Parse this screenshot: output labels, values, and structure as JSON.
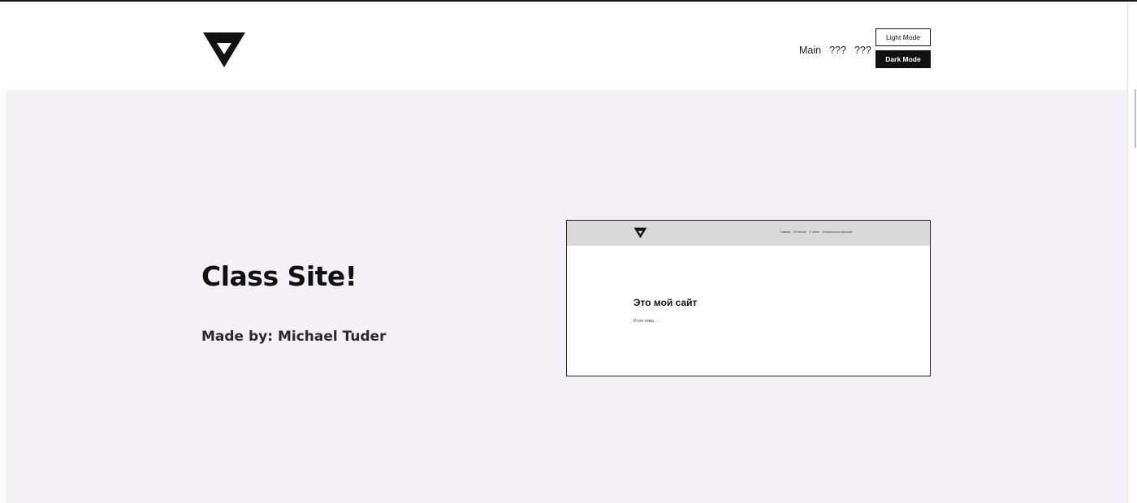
{
  "header": {
    "logo_icon": "inverted-triangle-logo",
    "nav": [
      {
        "label": "Main"
      },
      {
        "label": "???"
      },
      {
        "label": "???"
      }
    ],
    "light_mode_label": "Light Mode",
    "dark_mode_label": "Dark Mode"
  },
  "hero": {
    "title": "Class Site!",
    "subtitle": "Made by: Michael Tuder"
  },
  "preview": {
    "logo_icon": "inverted-triangle-logo",
    "nav": [
      "Главная",
      "Об авторе",
      "О сайте",
      "Специальные функции"
    ],
    "title": "Это мой сайт",
    "text": "И его тема . . ."
  },
  "colors": {
    "hero_background": "#f3f1f5",
    "dark_button": "#111111",
    "preview_header": "#d9d9d9"
  }
}
